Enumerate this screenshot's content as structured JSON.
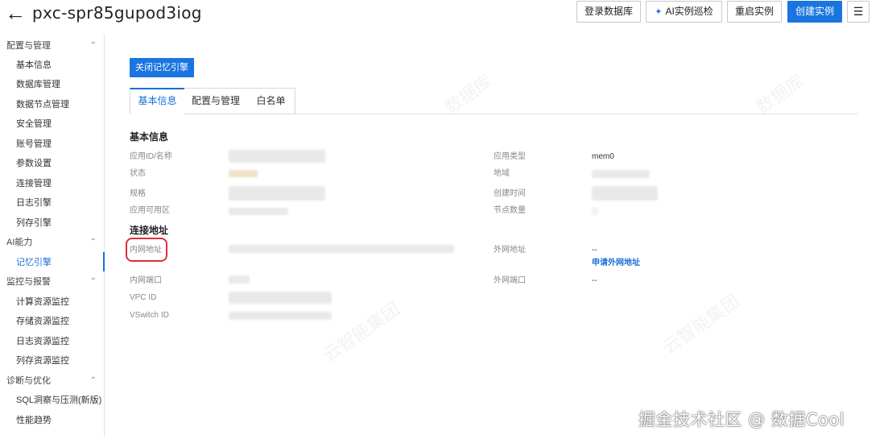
{
  "header": {
    "back_icon": "back-arrow-icon",
    "title": "pxc-spr85gupod3iog",
    "buttons": {
      "login_db": "登录数据库",
      "ai_patrol": "AI实例巡检",
      "restart": "重启实例",
      "create": "创建实例"
    },
    "menu_icon": "hamburger-menu-icon",
    "accent_color": "#1a75e0"
  },
  "sidebar": {
    "groups": [
      {
        "label": "配置与管理",
        "items": [
          "基本信息",
          "数据库管理",
          "数据节点管理",
          "安全管理",
          "账号管理",
          "参数设置",
          "连接管理",
          "日志引擎",
          "列存引擎"
        ]
      },
      {
        "label": "AI能力",
        "items": [
          "记忆引擎"
        ]
      },
      {
        "label": "监控与报警",
        "items": [
          "计算资源监控",
          "存储资源监控",
          "日志资源监控",
          "列存资源监控"
        ]
      },
      {
        "label": "诊断与优化",
        "items": [
          "SQL洞察与压测(新版)",
          "性能趋势"
        ]
      }
    ],
    "active_item": "记忆引擎"
  },
  "main": {
    "close_button": "关闭记忆引擎",
    "tabs": [
      "基本信息",
      "配置与管理",
      "白名单"
    ],
    "active_tab": "基本信息",
    "basic_info": {
      "title": "基本信息",
      "left_labels": [
        "应用ID/名称",
        "状态",
        "规格",
        "应用可用区"
      ],
      "right_labels": [
        "应用类型",
        "地域",
        "创建时间",
        "节点数量"
      ],
      "app_type_value": "mem0"
    },
    "connection": {
      "title": "连接地址",
      "internal_addr_label": "内网地址",
      "external_addr_label": "外网地址",
      "external_addr_value": "--",
      "apply_external_link": "申请外网地址",
      "internal_port_label": "内网端口",
      "external_port_label": "外网端口",
      "external_port_value": "--",
      "vpc_label": "VPC ID",
      "vswitch_label": "VSwitch ID"
    }
  },
  "watermarks": {
    "name_mark": "数据库",
    "org_mark": "云智能集团",
    "footer": "掘金技术社区 @ 数据Cool"
  }
}
